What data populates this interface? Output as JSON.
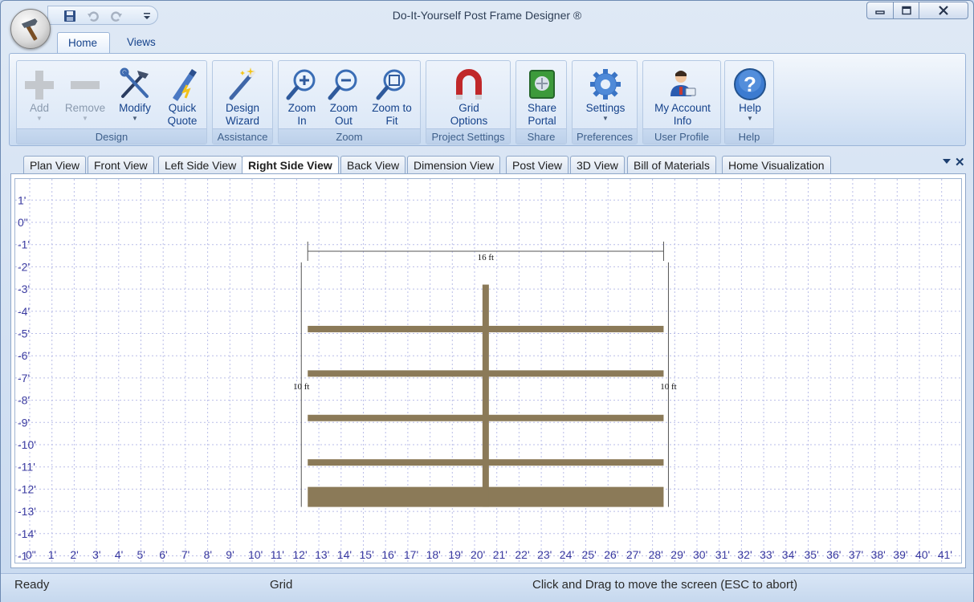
{
  "window": {
    "title": "Do-It-Yourself Post Frame Designer ®"
  },
  "qat": {
    "icons": [
      "save-icon",
      "undo-icon",
      "redo-icon",
      "customize-dropdown-icon"
    ]
  },
  "ribbon_tabs": [
    {
      "label": "Home",
      "active": true
    },
    {
      "label": "Views",
      "active": false
    }
  ],
  "ribbon": {
    "groups": {
      "design": "Design",
      "assistance": "Assistance",
      "zoom": "Zoom",
      "project_settings": "Project Settings",
      "share": "Share",
      "preferences": "Preferences",
      "user_profile": "User Profile",
      "help": "Help"
    },
    "buttons": {
      "add": {
        "l1": "Add",
        "l2": "",
        "disabled": true,
        "dropdown": true
      },
      "remove": {
        "l1": "Remove",
        "l2": "",
        "disabled": true,
        "dropdown": true
      },
      "modify": {
        "l1": "Modify",
        "l2": "",
        "dropdown": true
      },
      "quick_quote": {
        "l1": "Quick",
        "l2": "Quote"
      },
      "design_wizard": {
        "l1": "Design",
        "l2": "Wizard"
      },
      "zoom_in": {
        "l1": "Zoom",
        "l2": "In"
      },
      "zoom_out": {
        "l1": "Zoom",
        "l2": "Out"
      },
      "zoom_to_fit": {
        "l1": "Zoom to",
        "l2": "Fit"
      },
      "grid_options": {
        "l1": "Grid",
        "l2": "Options"
      },
      "share_portal": {
        "l1": "Share",
        "l2": "Portal"
      },
      "settings": {
        "l1": "Settings",
        "l2": "",
        "dropdown": true
      },
      "my_account": {
        "l1": "My Account",
        "l2": "Info"
      },
      "help": {
        "l1": "Help",
        "l2": "",
        "dropdown": true
      }
    }
  },
  "doc_tabs": [
    {
      "label": "Plan View",
      "active": false
    },
    {
      "label": "Front View",
      "active": false
    },
    {
      "label": "Left Side View",
      "active": false
    },
    {
      "label": "Right Side View",
      "active": true
    },
    {
      "label": "Back View",
      "active": false
    },
    {
      "label": "Dimension View",
      "active": false
    },
    {
      "label": "Post View",
      "active": false
    },
    {
      "label": "3D View",
      "active": false
    },
    {
      "label": "Bill of Materials",
      "active": false
    },
    {
      "label": "Home Visualization",
      "active": false
    }
  ],
  "drawing": {
    "y_ticks": [
      "1'",
      "0\"",
      "-1'",
      "-2'",
      "-3'",
      "-4'",
      "-5'",
      "-6'",
      "-7'",
      "-8'",
      "-9'",
      "-10'",
      "-11'",
      "-12'",
      "-13'",
      "-14'",
      "-1"
    ],
    "x_ticks": [
      "0\"",
      "1'",
      "2'",
      "3'",
      "4'",
      "5'",
      "6'",
      "7'",
      "8'",
      "9'",
      "10'",
      "11'",
      "12'",
      "13'",
      "14'",
      "15'",
      "16'",
      "17'",
      "18'",
      "19'",
      "20'",
      "21'",
      "22'",
      "23'",
      "24'",
      "25'",
      "26'",
      "27'",
      "28'",
      "29'",
      "30'",
      "31'",
      "32'",
      "33'",
      "34'",
      "35'",
      "36'",
      "37'",
      "38'",
      "39'",
      "40'",
      "41'"
    ],
    "width_dim_label": "16 ft",
    "left_height_label": "10 ft",
    "right_height_label": "10 ft",
    "wall_start_ft": 12.5,
    "wall_end_ft": 28.5,
    "post_x_ft": 20.5,
    "post_top_ft": -2.8,
    "girt_rows_ft": [
      -4.8,
      -6.8,
      -8.8,
      -10.8
    ],
    "splash_top_ft": -11.9,
    "ground_ft": -12.8,
    "wood_color": "#8b7a58",
    "grid_color": "#b9bde8",
    "axis_label_color": "#3a3aa0"
  },
  "status": {
    "left": "Ready",
    "middle": "Grid",
    "right": "Click and Drag to move the screen  (ESC to abort)"
  }
}
